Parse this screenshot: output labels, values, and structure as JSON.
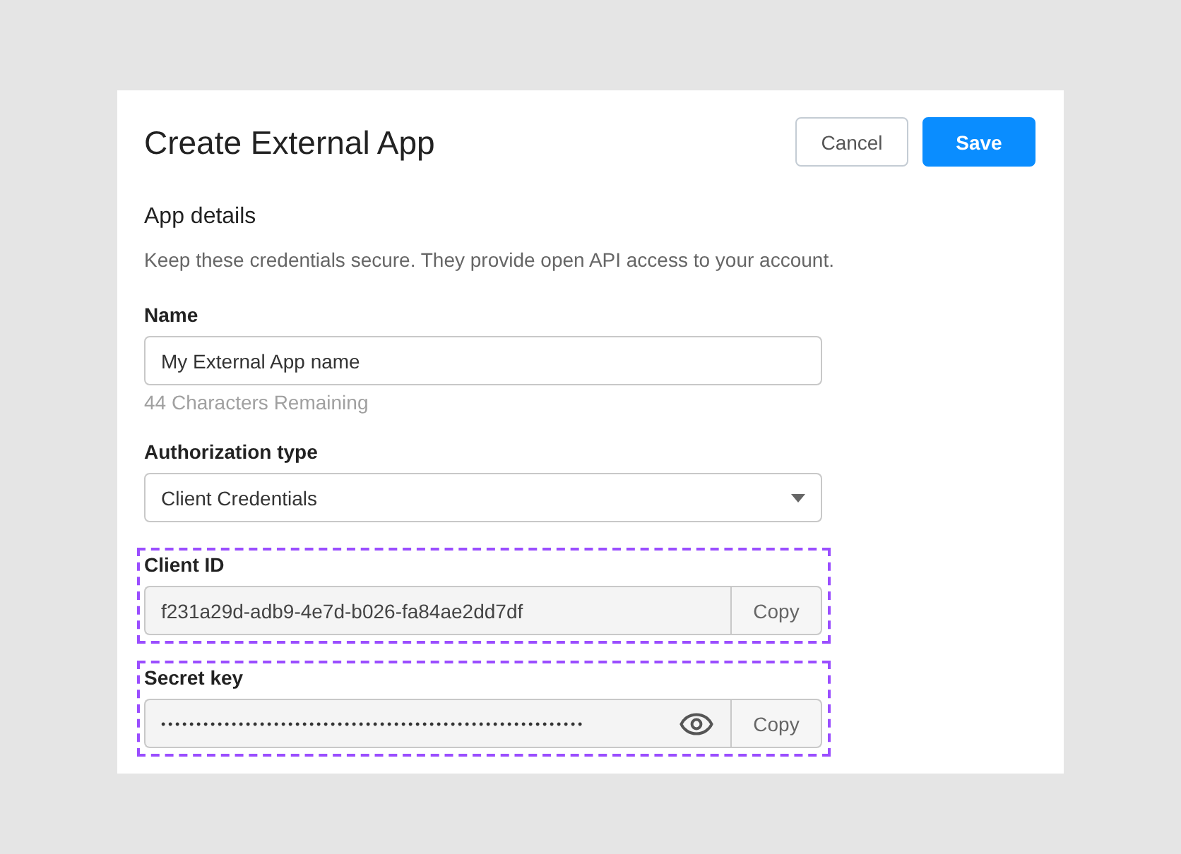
{
  "header": {
    "title": "Create External App",
    "buttons": [
      {
        "label": "Cancel",
        "kind": "secondary"
      },
      {
        "label": "Save",
        "kind": "primary"
      }
    ]
  },
  "section": {
    "title": "App details",
    "description": "Keep these credentials secure. They provide open API access to your account."
  },
  "fields": [
    {
      "kind": "text",
      "label": "Name",
      "value": "My External App name",
      "helper": "44 Characters Remaining",
      "outlined": false
    },
    {
      "kind": "select",
      "label": "Authorization type",
      "value": "Client Credentials",
      "outlined": false
    },
    {
      "kind": "copy",
      "label": "Client ID",
      "value": "f231a29d-adb9-4e7d-b026-fa84ae2dd7df",
      "action": "Copy",
      "outlined": true
    },
    {
      "kind": "secret",
      "label": "Secret key",
      "value": "••••••••••••••••••••••••••••••••••••••••••••••••••••••••••••",
      "action": "Copy",
      "outlined": true
    }
  ]
}
